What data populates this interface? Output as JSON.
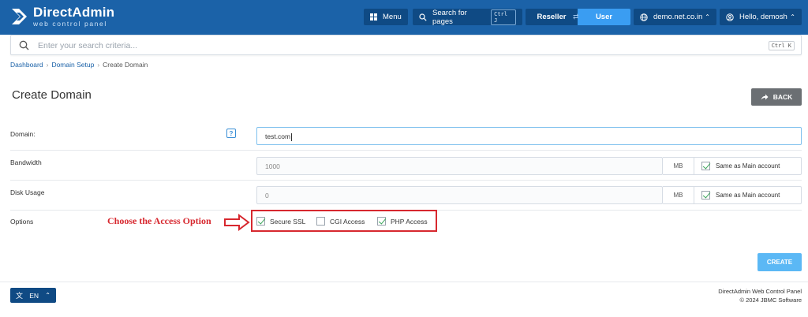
{
  "header": {
    "logo_title": "DirectAdmin",
    "logo_subtitle": "web control panel",
    "menu_label": "Menu",
    "search_pages_label": "Search for pages",
    "search_pages_shortcut": "Ctrl J",
    "role_reseller": "Reseller",
    "role_user": "User",
    "domain_selector": "demo.net.co.in",
    "greeting": "Hello, demosh"
  },
  "search": {
    "placeholder": "Enter your search criteria...",
    "shortcut": "Ctrl K"
  },
  "breadcrumb": [
    "Dashboard",
    "Domain Setup",
    "Create Domain"
  ],
  "page": {
    "title": "Create Domain",
    "back_label": "BACK"
  },
  "form": {
    "domain": {
      "label": "Domain:",
      "value": "test.com",
      "help": "?"
    },
    "bandwidth": {
      "label": "Bandwidth",
      "value": "1000",
      "unit": "MB",
      "same_label": "Same as Main account",
      "same_checked": true
    },
    "disk_usage": {
      "label": "Disk Usage",
      "value": "0",
      "unit": "MB",
      "same_label": "Same as Main account",
      "same_checked": true
    },
    "options": {
      "label": "Options",
      "items": [
        {
          "label": "Secure SSL",
          "checked": true
        },
        {
          "label": "CGI Access",
          "checked": false
        },
        {
          "label": "PHP Access",
          "checked": true
        }
      ]
    },
    "create_label": "CREATE"
  },
  "annotation": {
    "text": "Choose the Access Option",
    "color": "#d7282f"
  },
  "footer": {
    "language": "EN",
    "line1": "DirectAdmin Web Control Panel",
    "line2": "© 2024 JBMC Software"
  },
  "colors": {
    "header_bg": "#1b62a8",
    "button_dark": "#0f4a84",
    "accent": "#3a9df2",
    "create_btn": "#5bb8f5"
  }
}
